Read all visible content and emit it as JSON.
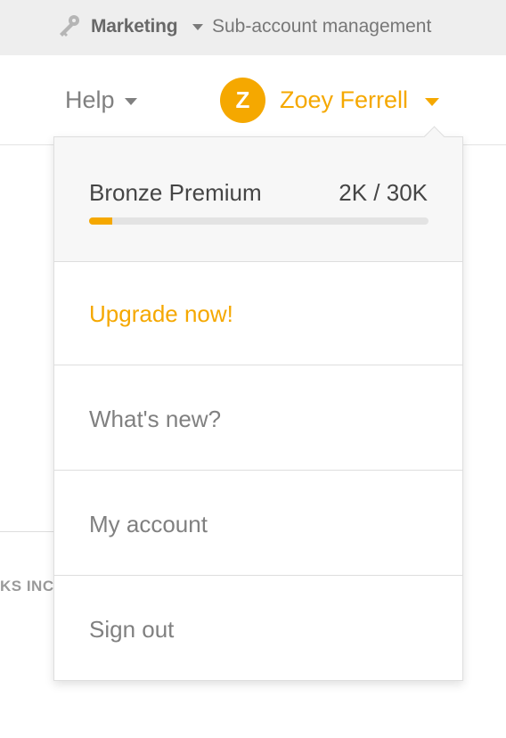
{
  "topbar": {
    "account_name": "Marketing",
    "subaccount_label": "Sub-account management",
    "icons": {
      "account": "key-icon",
      "caret": "caret-down-icon"
    }
  },
  "navbar": {
    "help_label": "Help",
    "user": {
      "initial": "Z",
      "name": "Zoey Ferrell"
    },
    "icons": {
      "help_caret": "caret-down-icon",
      "user_caret": "caret-down-icon"
    }
  },
  "background": {
    "partial_text": "KS INC"
  },
  "dropdown": {
    "plan": {
      "name": "Bronze Premium",
      "usage": "2K / 30K",
      "usage_fraction": 0.067
    },
    "items": [
      {
        "label": "Upgrade now!"
      },
      {
        "label": "What's new?"
      },
      {
        "label": "My account"
      },
      {
        "label": "Sign out"
      }
    ]
  },
  "colors": {
    "accent": "#f5a800",
    "topbar_bg": "#eeeeee",
    "text_muted": "#808080",
    "text_dark": "#454545"
  }
}
